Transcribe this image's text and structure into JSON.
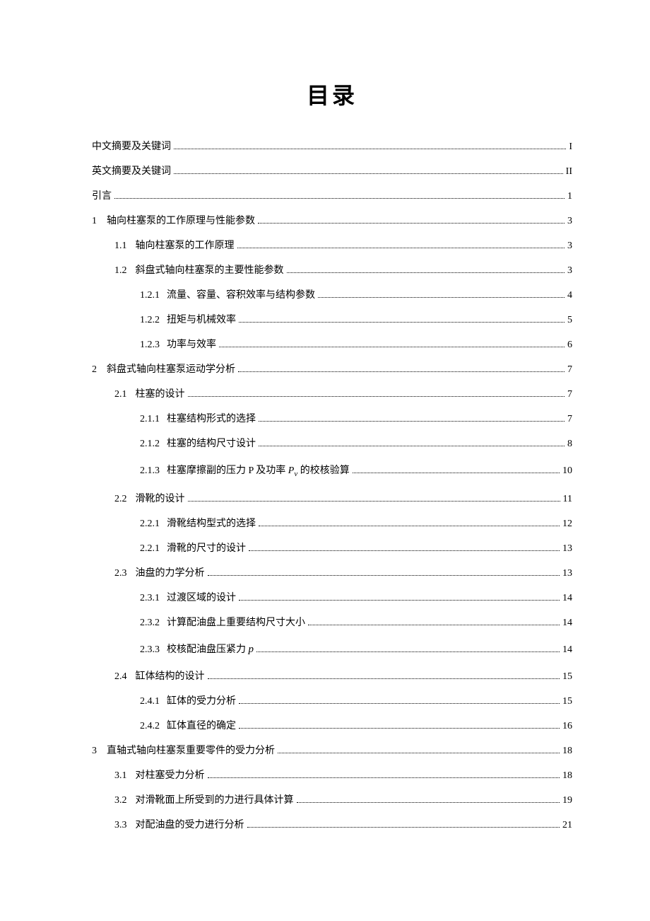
{
  "title": "目录",
  "entries": [
    {
      "level": 0,
      "num": "",
      "label": "中文摘要及关键词",
      "page": "I"
    },
    {
      "level": 0,
      "num": "",
      "label": "英文摘要及关键词",
      "page": "II"
    },
    {
      "level": 0,
      "num": "",
      "label": "引言",
      "page": "1"
    },
    {
      "level": 0,
      "num": "1",
      "label": "轴向柱塞泵的工作原理与性能参数",
      "page": "3"
    },
    {
      "level": 1,
      "num": "1.1",
      "label": "轴向柱塞泵的工作原理",
      "page": "3"
    },
    {
      "level": 1,
      "num": "1.2",
      "label": "斜盘式轴向柱塞泵的主要性能参数",
      "page": "3"
    },
    {
      "level": 2,
      "num": "1.2.1",
      "label": "流量、容量、容积效率与结构参数",
      "page": "4"
    },
    {
      "level": 2,
      "num": "1.2.2",
      "label": "扭矩与机械效率",
      "page": "5"
    },
    {
      "level": 2,
      "num": "1.2.3",
      "label": "功率与效率",
      "page": "6"
    },
    {
      "level": 0,
      "num": "2",
      "label": "斜盘式轴向柱塞泵运动学分析",
      "page": "7"
    },
    {
      "level": 1,
      "num": "2.1",
      "label": "柱塞的设计",
      "page": "7"
    },
    {
      "level": 2,
      "num": "2.1.1",
      "label": "柱塞结构形式的选择",
      "page": "7"
    },
    {
      "level": 2,
      "num": "2.1.2",
      "label": "柱塞的结构尺寸设计",
      "page": "8",
      "gap": true
    },
    {
      "level": 2,
      "num": "2.1.3",
      "label": "柱塞摩擦副的压力 P 及功率 ",
      "suffix_html": "<span class=\"ital\">P</span><span class=\"sup\">v</span> 的校核验算",
      "page": "10",
      "gap": true
    },
    {
      "level": 1,
      "num": "2.2",
      "label": "滑靴的设计",
      "page": "11"
    },
    {
      "level": 2,
      "num": "2.2.1",
      "label": "滑靴结构型式的选择",
      "page": "12"
    },
    {
      "level": 2,
      "num": "2.2.1",
      "label": "滑靴的尺寸的设计",
      "page": "13"
    },
    {
      "level": 1,
      "num": "2.3",
      "label": "油盘的力学分析",
      "page": "13"
    },
    {
      "level": 2,
      "num": "2.3.1",
      "label": "过渡区域的设计",
      "page": "14"
    },
    {
      "level": 2,
      "num": "2.3.2",
      "label": "计算配油盘上重要结构尺寸大小",
      "page": "14",
      "gap": true
    },
    {
      "level": 2,
      "num": "2.3.3",
      "label": "校核配油盘压紧力 ",
      "suffix_html": "<span class=\"ital\" style=\"font-size:15px\">p</span> ",
      "page": "14",
      "gap": true
    },
    {
      "level": 1,
      "num": "2.4",
      "label": "缸体结构的设计",
      "page": "15"
    },
    {
      "level": 2,
      "num": "2.4.1",
      "label": "缸体的受力分析",
      "page": "15"
    },
    {
      "level": 2,
      "num": "2.4.2",
      "label": "缸体直径的确定",
      "page": "16"
    },
    {
      "level": 0,
      "num": "3",
      "label": "直轴式轴向柱塞泵重要零件的受力分析",
      "page": "18"
    },
    {
      "level": 1,
      "num": "3.1",
      "label": "对柱塞受力分析",
      "page": "18"
    },
    {
      "level": 1,
      "num": "3.2",
      "label": "对滑靴面上所受到的力进行具体计算",
      "page": "19"
    },
    {
      "level": 1,
      "num": "3.3",
      "label": "对配油盘的受力进行分析",
      "page": "21"
    }
  ]
}
